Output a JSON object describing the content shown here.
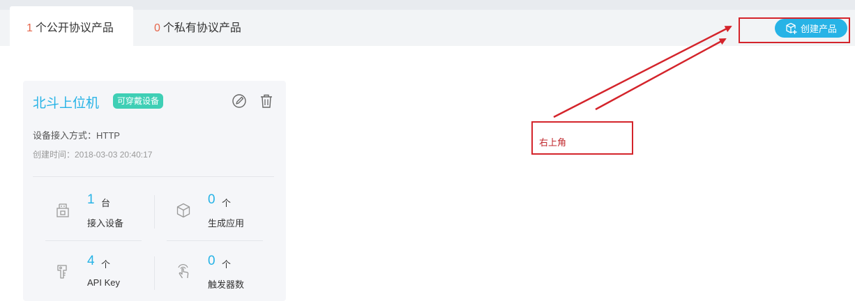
{
  "tabs": {
    "public": {
      "count": "1",
      "label": "个公开协议产品"
    },
    "private": {
      "count": "0",
      "label": "个私有协议产品"
    }
  },
  "toolbar": {
    "create_label": "创建产品"
  },
  "product_card": {
    "name": "北斗上位机",
    "tag": "可穿戴设备",
    "access_method": "设备接入方式：HTTP",
    "created_time": "创建时间：2018-03-03 20:40:17",
    "stats": [
      {
        "icon": "device-icon",
        "value": "1",
        "unit": "台",
        "label": "接入设备"
      },
      {
        "icon": "cube-icon",
        "value": "0",
        "unit": "个",
        "label": "生成应用"
      },
      {
        "icon": "key-icon",
        "value": "4",
        "unit": "个",
        "label": "API Key"
      },
      {
        "icon": "touch-icon",
        "value": "0",
        "unit": "个",
        "label": "触发器数"
      }
    ]
  },
  "annotation": {
    "label": "右上角",
    "color": "#d4242b"
  },
  "colors": {
    "accent": "#27b3e6",
    "tag": "#3fcfb5",
    "count_red": "#e5654a"
  }
}
